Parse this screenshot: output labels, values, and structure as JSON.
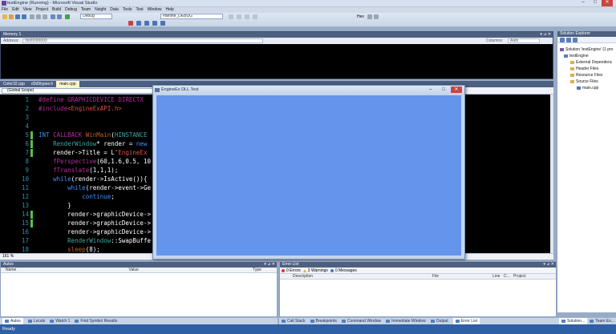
{
  "window": {
    "title": "testEngine (Running) - Microsoft Visual Studio"
  },
  "menu": [
    "File",
    "Edit",
    "View",
    "Project",
    "Build",
    "Debug",
    "Team",
    "Nsight",
    "Data",
    "Tools",
    "Test",
    "Window",
    "Help"
  ],
  "toolbar": {
    "config": "Debug",
    "define_combo": "#define_DEBUG",
    "hex_label": "Hex"
  },
  "memory": {
    "title": "Memory 1",
    "address_label": "Address:",
    "address_value": "0x00000000",
    "columns_label": "Columns:",
    "columns_value": "Auto"
  },
  "tabs": [
    {
      "label": "Color32.cpp",
      "active": false
    },
    {
      "label": "d3d9types.h",
      "active": false
    },
    {
      "label": "main.cpp",
      "active": true
    }
  ],
  "editor": {
    "scope": "(Global Scope)",
    "zoom": "161 %",
    "lines": [
      {
        "n": "1",
        "html": "<span class='pp'>#define</span> <span class='pp'>GRAPHICDEVICE DIRECTX</span>"
      },
      {
        "n": "2",
        "html": "<span class='pp'>#include</span><span class='str'>&lt;EngineExAPI.h&gt;</span>"
      },
      {
        "n": "3",
        "html": ""
      },
      {
        "n": "4",
        "html": ""
      },
      {
        "n": "5",
        "html": "<span class='kw'>INT</span> <span class='pp'>CALLBACK</span> <span class='fn'>WinMain</span>(<span class='ty'>HINSTANCE</span>"
      },
      {
        "n": "6",
        "html": "    <span class='ty'>RenderWindow</span>* render = <span class='kw'>new</span>"
      },
      {
        "n": "7",
        "html": "    render-&gt;Title = L<span class='str'>\"EngineEx</span>"
      },
      {
        "n": "8",
        "html": "    <span class='pp'>fPerspective</span>(60,1.6,0.5, 10"
      },
      {
        "n": "9",
        "html": "    <span class='pp'>fTranslate</span>(1,1,1);"
      },
      {
        "n": "10",
        "html": "    <span class='kw'>while</span>(render-&gt;IsActive()){"
      },
      {
        "n": "11",
        "html": "        <span class='kw'>while</span>(render-&gt;event-&gt;Ge"
      },
      {
        "n": "12",
        "html": "            <span class='kw'>continue</span>;"
      },
      {
        "n": "13",
        "html": "        }"
      },
      {
        "n": "14",
        "html": "        render-&gt;graphicDevice-&gt;"
      },
      {
        "n": "15",
        "html": "        render-&gt;graphicDevice-&gt;                                                  149,237),1,0);"
      },
      {
        "n": "16",
        "html": "        render-&gt;graphicDevice-&gt;"
      },
      {
        "n": "17",
        "html": "        <span class='ty'>RenderWindow</span>::SwapBuffe"
      },
      {
        "n": "18",
        "html": "        <span class='fn'>sleep</span>(8);"
      }
    ]
  },
  "dialog": {
    "title": "EngineEx DLL Test",
    "bg_color": "#6495ed"
  },
  "solution_explorer": {
    "title": "Solution Explorer",
    "items": [
      "Solution 'testEngine' (1 pro",
      "testEngine",
      "External Dependenc",
      "Header Files",
      "Resource Files",
      "Source Files",
      "main.cpp"
    ]
  },
  "autos": {
    "title": "Autos",
    "columns": [
      "Name",
      "Value",
      "Type"
    ]
  },
  "error_list": {
    "title": "Error List",
    "errors": "0 Errors",
    "warnings": "3 Warnings",
    "messages": "0 Messages",
    "columns": [
      "Description",
      "File",
      "Line",
      "C...",
      "Project"
    ]
  },
  "bottom_tabs_left": [
    "Autos",
    "Locals",
    "Watch 1",
    "Find Symbol Results"
  ],
  "bottom_tabs_right": [
    "Call Stack",
    "Breakpoints",
    "Command Window",
    "Immediate Window",
    "Output",
    "Error List"
  ],
  "bottom_tabs_far": [
    "Solution...",
    "Team Ex..."
  ],
  "status": "Ready"
}
